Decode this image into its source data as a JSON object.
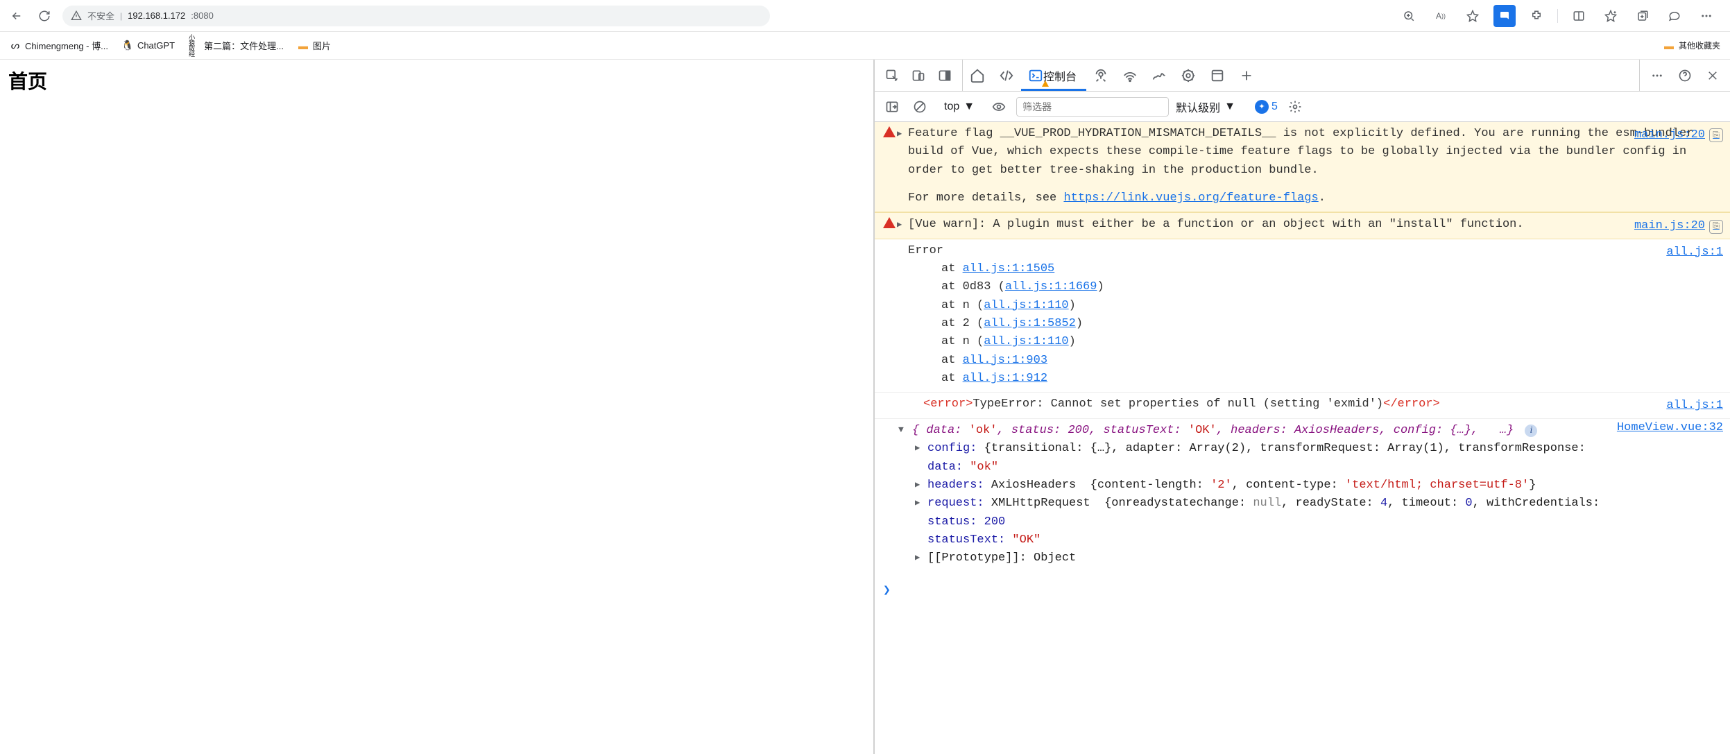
{
  "browser": {
    "insecure_label": "不安全",
    "host": "192.168.1.172",
    "port": ":8080"
  },
  "bookmarks": {
    "items": [
      {
        "label": "Chimengmeng - 博..."
      },
      {
        "label": "ChatGPT"
      },
      {
        "label": "第二篇：文件处理..."
      },
      {
        "label": "图片"
      }
    ],
    "other": "其他收藏夹"
  },
  "page": {
    "title": "首页"
  },
  "devtools": {
    "console_tab": "控制台",
    "toolbar": {
      "context": "top",
      "filter_placeholder": "筛选器",
      "level": "默认级别",
      "issues_count": "5"
    },
    "messages": {
      "warn1": {
        "text": "Feature flag __VUE_PROD_HYDRATION_MISMATCH_DETAILS__ is not explicitly defined. You are running the esm-bundler build of Vue, which expects these compile-time feature flags to be globally injected via the bundler config in order to get better tree-shaking in the production bundle.",
        "more_prefix": "For more details, see ",
        "more_link": "https://link.vuejs.org/feature-flags",
        "src": "main.js:20"
      },
      "warn2": {
        "text": "[Vue warn]: A plugin must either be a function or an object with an \"install\" function.",
        "src": "main.js:20"
      },
      "error1": {
        "head": "Error",
        "src": "all.js:1",
        "frames": [
          {
            "pre": "at ",
            "link": "all.js:1:1505"
          },
          {
            "pre": "at 0d83 (",
            "link": "all.js:1:1669",
            "post": ")"
          },
          {
            "pre": "at n (",
            "link": "all.js:1:110",
            "post": ")"
          },
          {
            "pre": "at 2 (",
            "link": "all.js:1:5852",
            "post": ")"
          },
          {
            "pre": "at n (",
            "link": "all.js:1:110",
            "post": ")"
          },
          {
            "pre": "at ",
            "link": "all.js:1:903"
          },
          {
            "pre": "at ",
            "link": "all.js:1:912"
          }
        ]
      },
      "error2": {
        "open_tag": "<error>",
        "body": "TypeError: Cannot set properties of null (setting 'exmid')",
        "close_tag": "</error>",
        "src": "all.js:1"
      },
      "obj": {
        "src": "HomeView.vue:32",
        "summary_prefix": "{",
        "summary_data_key": "data:",
        "summary_data_val": "'ok'",
        "summary_status_key": "status:",
        "summary_status_val": "200",
        "summary_statusText_key": "statusText:",
        "summary_statusText_val": "'OK'",
        "summary_headers_key": "headers:",
        "summary_headers_val": "AxiosHeaders",
        "summary_config_key": "config:",
        "summary_config_val": "{…}",
        "summary_trail": "…}",
        "config_line_key": "config:",
        "config_line_body": "{transitional: {…}, adapter: Array(2), transformRequest: Array(1), transformResponse:",
        "data_line_key": "data:",
        "data_line_val": "\"ok\"",
        "headers_line_key": "headers:",
        "headers_line_type": "AxiosHeaders",
        "headers_line_body1": "{content-length: ",
        "headers_line_val1": "'2'",
        "headers_line_body2": ", content-type: ",
        "headers_line_val2": "'text/html; charset=utf-8'",
        "headers_line_close": "}",
        "request_line_key": "request:",
        "request_line_type": "XMLHttpRequest",
        "request_line_body": "{onreadystatechange: ",
        "request_null": "null",
        "request_rs": ", readyState: ",
        "request_rs_v": "4",
        "request_to": ", timeout: ",
        "request_to_v": "0",
        "request_wc": ", withCredentials:",
        "status_key": "status:",
        "status_val": "200",
        "statusText_key": "statusText:",
        "statusText_val": "\"OK\"",
        "proto_key": "[[Prototype]]:",
        "proto_val": "Object"
      }
    }
  }
}
